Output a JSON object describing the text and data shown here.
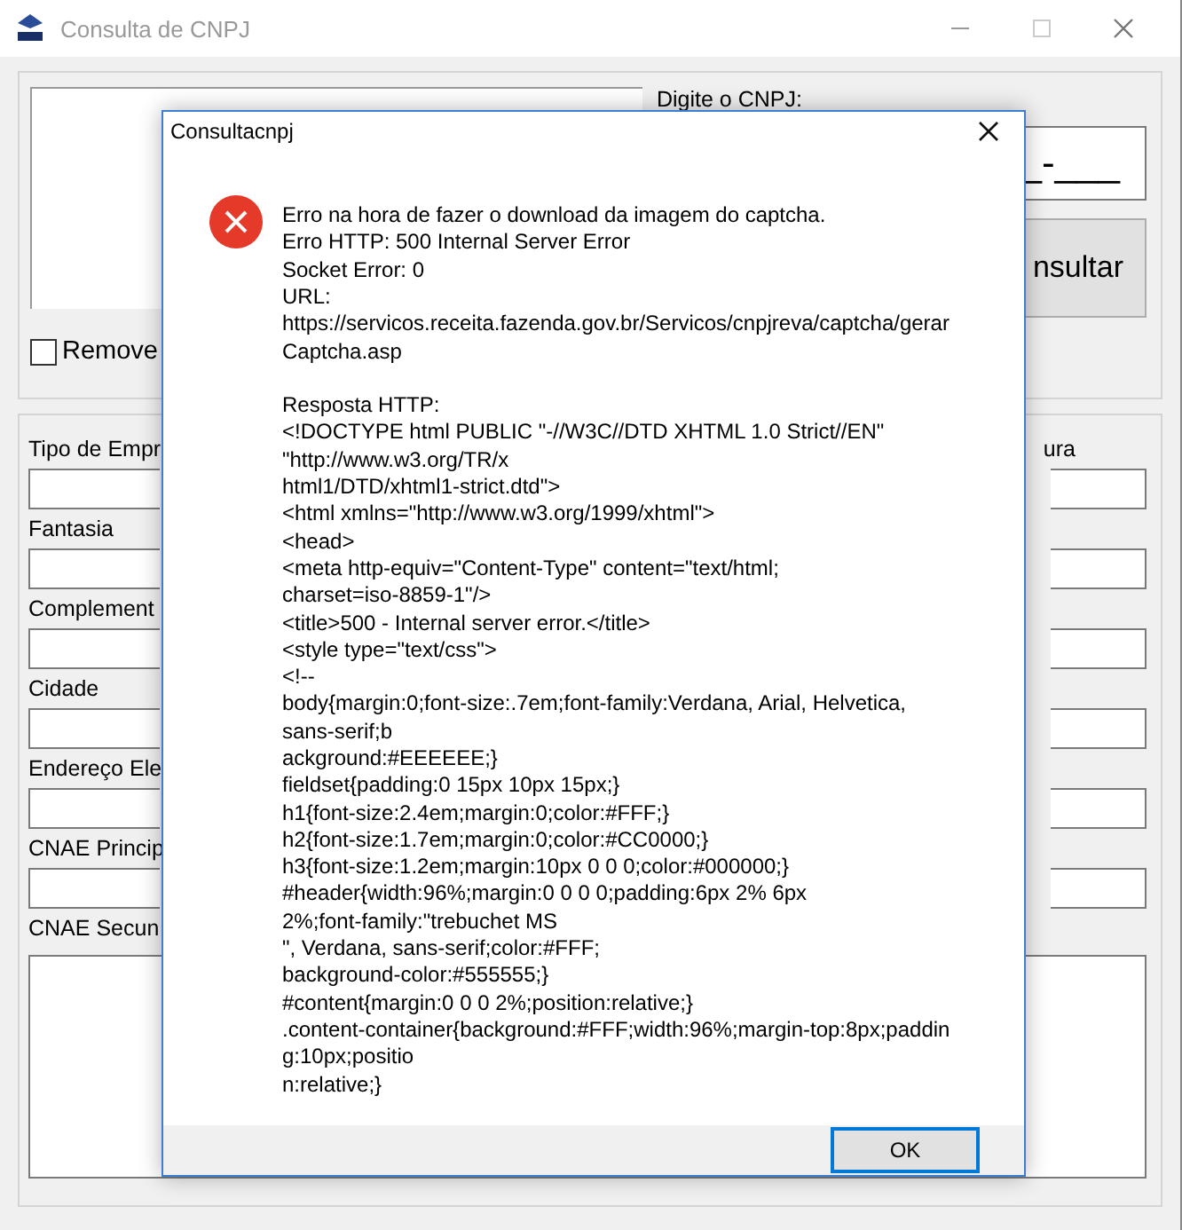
{
  "window": {
    "title": "Consulta de CNPJ"
  },
  "cnpj": {
    "label": "Digite o CNPJ:",
    "value": "_-___"
  },
  "consult_button": {
    "label": "nsultar"
  },
  "remove_checkbox": {
    "label": "Remove",
    "checked": false
  },
  "fields": [
    {
      "label": "Tipo de Empr",
      "kind": "line"
    },
    {
      "label": "Fantasia",
      "kind": "line"
    },
    {
      "label": "Complement",
      "kind": "line"
    },
    {
      "label": "Cidade",
      "kind": "line"
    },
    {
      "label": "Endereço Ele",
      "kind": "line"
    },
    {
      "label": "CNAE Princip",
      "kind": "line"
    },
    {
      "label": "CNAE Secun",
      "kind": "area"
    }
  ],
  "right_field": {
    "label": "ura"
  },
  "dialog": {
    "title": "Consultacnpj",
    "paragraphs": [
      "Erro na hora de fazer o download da imagem do captcha.\nErro HTTP: 500 Internal Server Error\nSocket Error: 0\nURL:\nhttps://servicos.receita.fazenda.gov.br/Servicos/cnpjreva/captcha/gerar\nCaptcha.asp",
      "Resposta HTTP:\n<!DOCTYPE html PUBLIC \"-//W3C//DTD XHTML 1.0 Strict//EN\"\n\"http://www.w3.org/TR/x\nhtml1/DTD/xhtml1-strict.dtd\">\n<html xmlns=\"http://www.w3.org/1999/xhtml\">\n<head>\n<meta http-equiv=\"Content-Type\" content=\"text/html;\ncharset=iso-8859-1\"/>\n<title>500 - Internal server error.</title>\n<style type=\"text/css\">\n<!--\nbody{margin:0;font-size:.7em;font-family:Verdana, Arial, Helvetica,\nsans-serif;b\nackground:#EEEEEE;}\nfieldset{padding:0 15px 10px 15px;}\nh1{font-size:2.4em;margin:0;color:#FFF;}\nh2{font-size:1.7em;margin:0;color:#CC0000;}\nh3{font-size:1.2em;margin:10px 0 0 0;color:#000000;}\n#header{width:96%;margin:0 0 0 0;padding:6px 2% 6px\n2%;font-family:\"trebuchet MS\n\", Verdana, sans-serif;color:#FFF;\nbackground-color:#555555;}\n#content{margin:0 0 0 2%;position:relative;}\n.content-container{background:#FFF;width:96%;margin-top:8px;paddin\ng:10px;positio\nn:relative;}"
    ],
    "buttons": [
      "OK"
    ]
  }
}
